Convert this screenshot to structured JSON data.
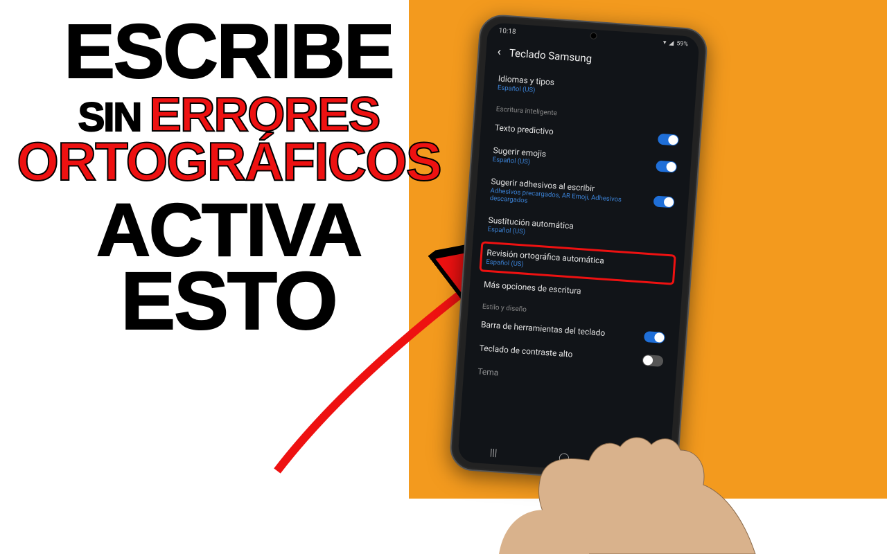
{
  "headline": {
    "l1": "ESCRIBE",
    "l2a": "SIN",
    "l2b": "ERRORES",
    "l3": "ORTOGRÁFICOS",
    "l4": "ACTIVA",
    "l5": "ESTO"
  },
  "phone": {
    "status": {
      "time": "10:18",
      "battery": "59%"
    },
    "header": {
      "title": "Teclado Samsung"
    },
    "rows": {
      "idiomas": {
        "title": "Idiomas y tipos",
        "sub": "Español (US)"
      },
      "section_smart": "Escritura inteligente",
      "predictivo": {
        "title": "Texto predictivo"
      },
      "emojis": {
        "title": "Sugerir emojis",
        "sub": "Español (US)"
      },
      "stickers": {
        "title": "Sugerir adhesivos al escribir",
        "sub": "Adhesivos precargados, AR Emoji, Adhesivos descargados"
      },
      "sustitucion": {
        "title": "Sustitución automática",
        "sub": "Español (US)"
      },
      "revision": {
        "title": "Revisión ortográfica automática",
        "sub": "Español (US)"
      },
      "masop": {
        "title": "Más opciones de escritura"
      },
      "section_estilo": "Estilo y diseño",
      "barra": {
        "title": "Barra de herramientas del teclado"
      },
      "contraste": {
        "title": "Teclado de contraste alto"
      },
      "tema": {
        "title": "Tema"
      }
    }
  }
}
